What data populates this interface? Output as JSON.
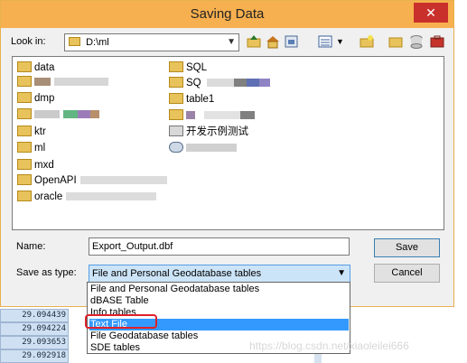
{
  "background_table": {
    "values": [
      "29.094439",
      "29.094224",
      "29.093653",
      "29.092918"
    ]
  },
  "dialog": {
    "title": "Saving Data",
    "close_glyph": "✕",
    "look_in_label": "Look in:",
    "look_in_value": "D:\\ml",
    "toolbar_icons": [
      "up-folder-icon",
      "home-icon",
      "connect-folder-icon",
      "view-list-icon",
      "view-dropdown-icon",
      "new-folder-icon",
      "folder-icon",
      "database-icon",
      "toolbox-icon"
    ],
    "files_left": [
      "data",
      "",
      "dmp",
      "",
      "ktr",
      "ml",
      "mxd",
      "OpenAPI",
      "oracle"
    ],
    "files_right": [
      "SQL",
      "SQ",
      "table1",
      "",
      "开发示例测试",
      ""
    ],
    "name_label": "Name:",
    "name_value": "Export_Output.dbf",
    "save_as_type_label": "Save as type:",
    "save_as_type_value": "File and Personal Geodatabase tables",
    "save_button": "Save",
    "cancel_button": "Cancel",
    "type_options": [
      "File and Personal Geodatabase tables",
      "dBASE Table",
      "Info tables",
      "Text File",
      "File Geodatabase tables",
      "SDE tables"
    ],
    "selected_option": "Text File"
  },
  "watermark": "https://blog.csdn.net/xiaoleilei666"
}
